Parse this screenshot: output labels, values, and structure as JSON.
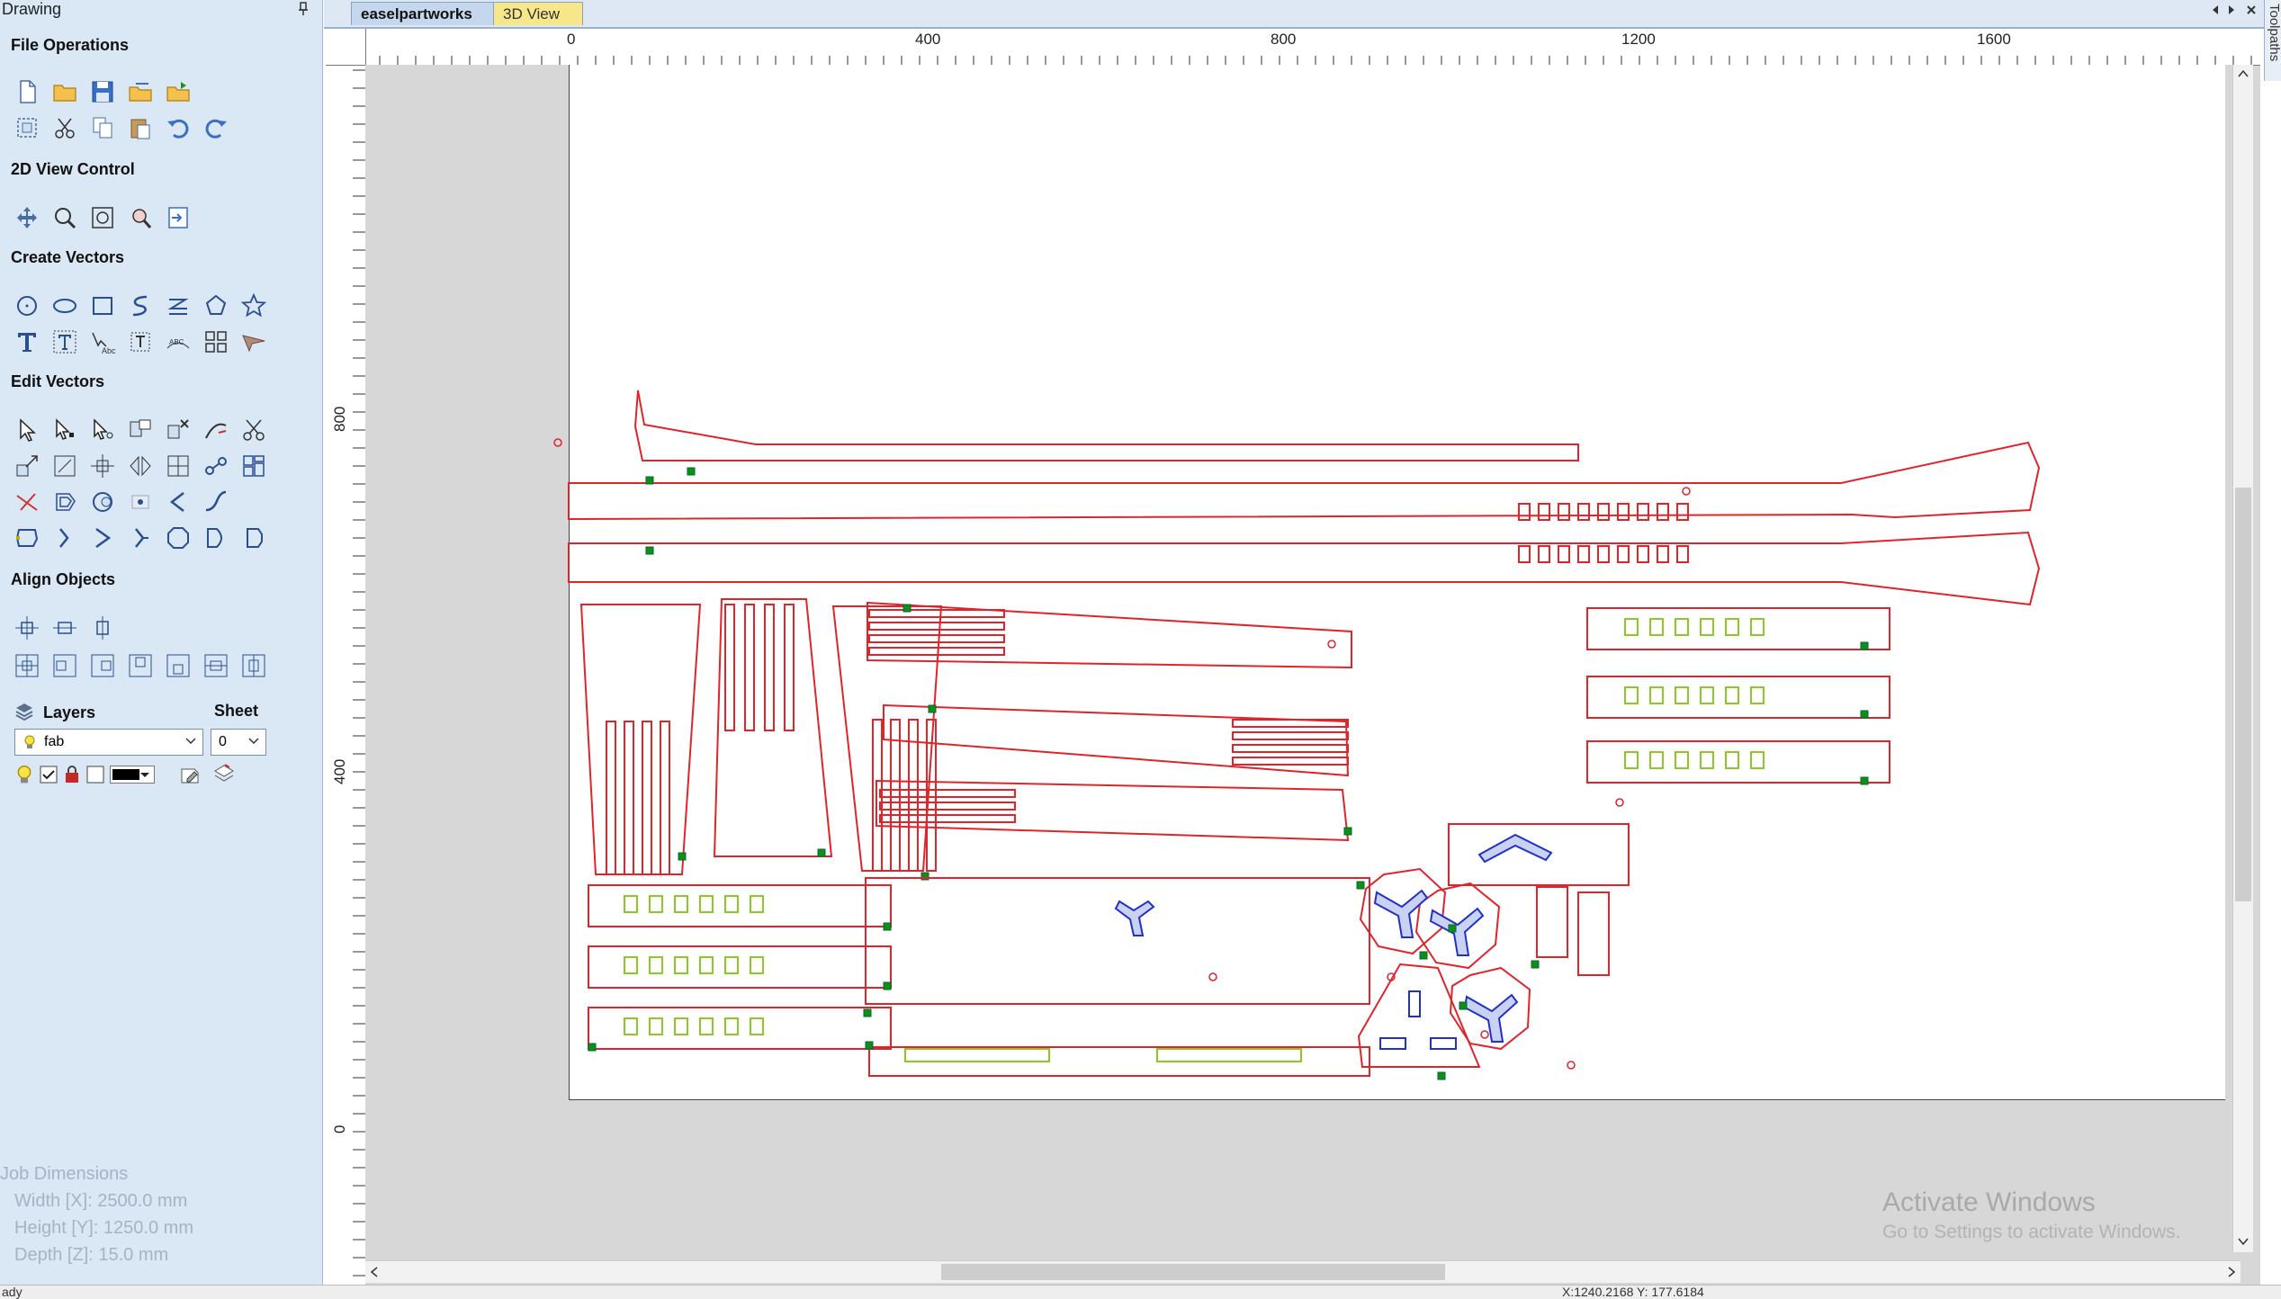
{
  "panel": {
    "title": "Drawing",
    "sections": {
      "file_ops": "File Operations",
      "view_control": "2D View Control",
      "create_vectors": "Create Vectors",
      "edit_vectors": "Edit Vectors",
      "align_objects": "Align Objects"
    },
    "layers_label": "Layers",
    "sheet_label": "Sheet",
    "layer_value": "fab",
    "sheet_value": "0",
    "job": {
      "title": "Job Dimensions",
      "width": "Width  [X]: 2500.0 mm",
      "height": "Height [Y]: 1250.0 mm",
      "depth": "Depth  [Z]: 15.0 mm"
    }
  },
  "tabs": {
    "active": "easelpartworks",
    "secondary": "3D View"
  },
  "ruler": {
    "top_labels": [
      "0",
      "400",
      "800",
      "1200",
      "1600"
    ],
    "left_labels": [
      "800",
      "400",
      "0"
    ]
  },
  "side_tab": "Toolpaths",
  "watermark": {
    "title": "Activate Windows",
    "subtitle": "Go to Settings to activate Windows."
  },
  "status": {
    "left": "ady",
    "coords": "X:1240.2168 Y: 177.6184"
  },
  "colors": {
    "cut_path": "#e0242c",
    "inner_path": "#2130c9",
    "pocket": "#8ac926",
    "node": "#109010"
  }
}
